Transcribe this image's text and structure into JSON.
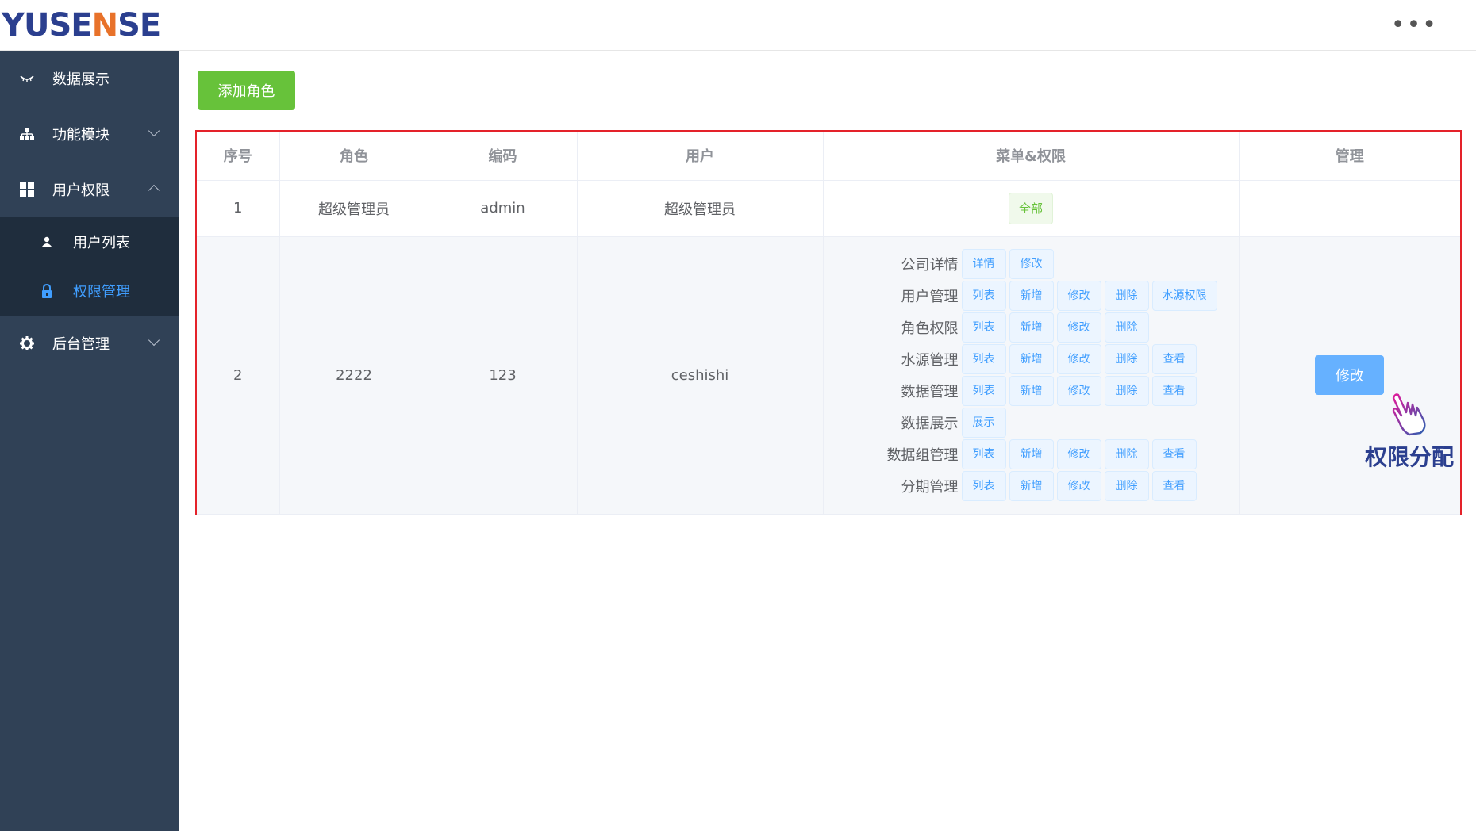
{
  "header": {
    "logo_pre": "YUSE",
    "logo_accent": "N",
    "logo_post": "SE",
    "more": "•••"
  },
  "sidebar": {
    "items": [
      {
        "label": "数据展示",
        "icon": "eye-icon"
      },
      {
        "label": "功能模块",
        "icon": "sitemap-icon"
      },
      {
        "label": "用户权限",
        "icon": "grid-icon",
        "expanded": true,
        "children": [
          {
            "label": "用户列表",
            "icon": "user-icon"
          },
          {
            "label": "权限管理",
            "icon": "lock-icon",
            "active": true
          }
        ]
      },
      {
        "label": "后台管理",
        "icon": "gear-icon"
      }
    ]
  },
  "toolbar": {
    "add_label": "添加角色"
  },
  "table": {
    "headers": [
      "序号",
      "角色",
      "编码",
      "用户",
      "菜单&权限",
      "管理"
    ],
    "rows": [
      {
        "index": "1",
        "role": "超级管理员",
        "code": "admin",
        "user": "超级管理员",
        "all_tag": "全部"
      },
      {
        "index": "2",
        "role": "2222",
        "code": "123",
        "user": "ceshishi",
        "perms": [
          {
            "name": "公司详情",
            "tags": [
              "详情",
              "修改"
            ]
          },
          {
            "name": "用户管理",
            "tags": [
              "列表",
              "新增",
              "修改",
              "删除",
              "水源权限"
            ]
          },
          {
            "name": "角色权限",
            "tags": [
              "列表",
              "新增",
              "修改",
              "删除"
            ]
          },
          {
            "name": "水源管理",
            "tags": [
              "列表",
              "新增",
              "修改",
              "删除",
              "查看"
            ]
          },
          {
            "name": "数据管理",
            "tags": [
              "列表",
              "新增",
              "修改",
              "删除",
              "查看"
            ]
          },
          {
            "name": "数据展示",
            "tags": [
              "展示"
            ]
          },
          {
            "name": "数据组管理",
            "tags": [
              "列表",
              "新增",
              "修改",
              "删除",
              "查看"
            ]
          },
          {
            "name": "分期管理",
            "tags": [
              "列表",
              "新增",
              "修改",
              "删除",
              "查看"
            ]
          }
        ],
        "edit_label": "修改"
      }
    ]
  },
  "annotation": {
    "text": "权限分配",
    "icon": "hand-pointer-icon",
    "color": "#2b3f8f"
  },
  "colors": {
    "sidebar": "#304156",
    "submenu": "#1f2d3d",
    "active": "#409eff",
    "success": "#67c23a",
    "highlight_border": "#e4222a"
  }
}
